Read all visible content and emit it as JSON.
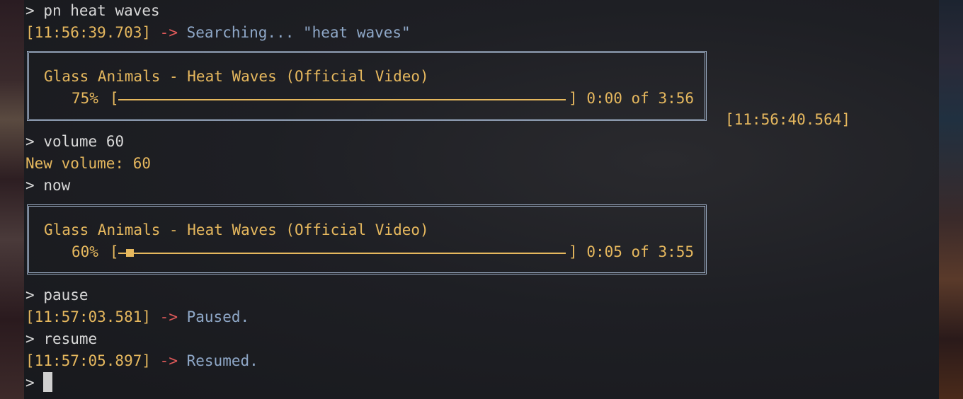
{
  "terminal": {
    "prompt": ">",
    "commands": {
      "play": "pn heat waves",
      "volume": "volume 60",
      "now": "now",
      "pause": "pause",
      "resume": "resume"
    },
    "search_line": {
      "timestamp": "[11:56:39.703]",
      "arrow": "->",
      "message": "Searching... \"heat waves\""
    },
    "player_box_1": {
      "title": "Glass Animals - Heat Waves (Official Video)",
      "volume_pct": "75%",
      "bracket_open": "[",
      "bracket_close": "]",
      "time": "0:00 of 3:56",
      "progress": 0.0
    },
    "side_timestamp": "[11:56:40.564]",
    "volume_response": "New volume: 60",
    "player_box_2": {
      "title": "Glass Animals - Heat Waves (Official Video)",
      "volume_pct": "60%",
      "bracket_open": "[",
      "bracket_close": "]",
      "time": "0:05 of 3:55",
      "progress": 0.02
    },
    "paused_line": {
      "timestamp": "[11:57:03.581]",
      "arrow": "->",
      "message": "Paused."
    },
    "resumed_line": {
      "timestamp": "[11:57:05.897]",
      "arrow": "->",
      "message": "Resumed."
    }
  },
  "colors": {
    "accent_yellow": "#e6b85e",
    "arrow_red": "#e05a5a",
    "message_blue": "#8fa8c8",
    "box_border": "#9fb0c8"
  }
}
